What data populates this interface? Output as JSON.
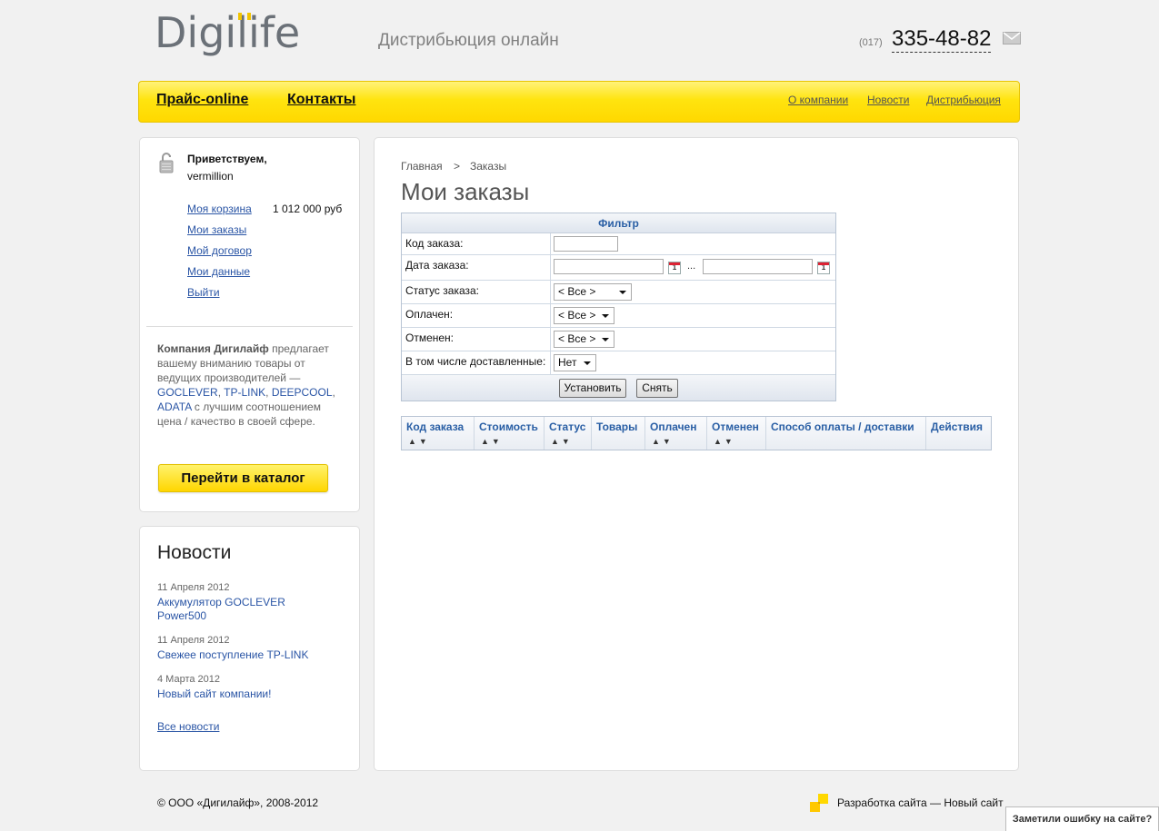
{
  "header": {
    "logo_text": "Digilife",
    "tagline": "Дистрибьюция онлайн",
    "phone_code": "(017)",
    "phone_number": "335-48-82"
  },
  "nav": {
    "main": [
      "Прайс-online",
      "Контакты"
    ],
    "secondary": [
      "О компании",
      "Новости",
      "Дистрибьюция"
    ]
  },
  "user_panel": {
    "greeting": "Приветствуем,",
    "username": "vermillion",
    "cart_label": "Моя корзина",
    "cart_sum": "1 012 000 руб",
    "links": [
      "Мои заказы",
      "Мой договор",
      "Мои данные",
      "Выйти"
    ]
  },
  "promo": {
    "company": "Компания Дигилайф",
    "text_1": " предлагает вашему вниманию товары от ведущих производителей — ",
    "brands": [
      "GOCLEVER",
      "TP-LINK",
      "DEEPCOOL",
      "ADATA"
    ],
    "text_2": " с лучшим соотношением цена / качество в своей сфере.",
    "button": "Перейти в каталог"
  },
  "news": {
    "title": "Новости",
    "items": [
      {
        "date": "11 Апреля 2012",
        "title": "Аккумулятор GOCLEVER Power500"
      },
      {
        "date": "11 Апреля 2012",
        "title": "Свежее поступление TP-LINK"
      },
      {
        "date": "4 Марта 2012",
        "title": "Новый сайт компании!"
      }
    ],
    "all_link": "Все новости"
  },
  "main": {
    "breadcrumb": [
      "Главная",
      ">",
      "Заказы"
    ],
    "title": "Мои заказы",
    "filter": {
      "header": "Фильтр",
      "order_code": "Код заказа:",
      "order_date": "Дата заказа:",
      "date_sep": "...",
      "calendar_glyph": "1",
      "status": "Статус заказа:",
      "status_value": "< Все >",
      "paid": "Оплачен:",
      "paid_value": "< Все >",
      "cancelled": "Отменен:",
      "cancelled_value": "< Все >",
      "delivered": "В том числе доставленные:",
      "delivered_value": "Нет",
      "apply": "Установить",
      "reset": "Снять"
    },
    "orders_table": {
      "columns": [
        "Код заказа",
        "Стоимость",
        "Статус",
        "Товары",
        "Оплачен",
        "Отменен",
        "Способ оплаты / доставки",
        "Действия"
      ],
      "sort_glyph": "▲▼"
    }
  },
  "footer": {
    "copyright": "© ООО «Дигилайф», 2008-2012",
    "developer": "Разработка сайта — Новый сайт",
    "error_tab": "Заметили ошибку на сайте?"
  }
}
